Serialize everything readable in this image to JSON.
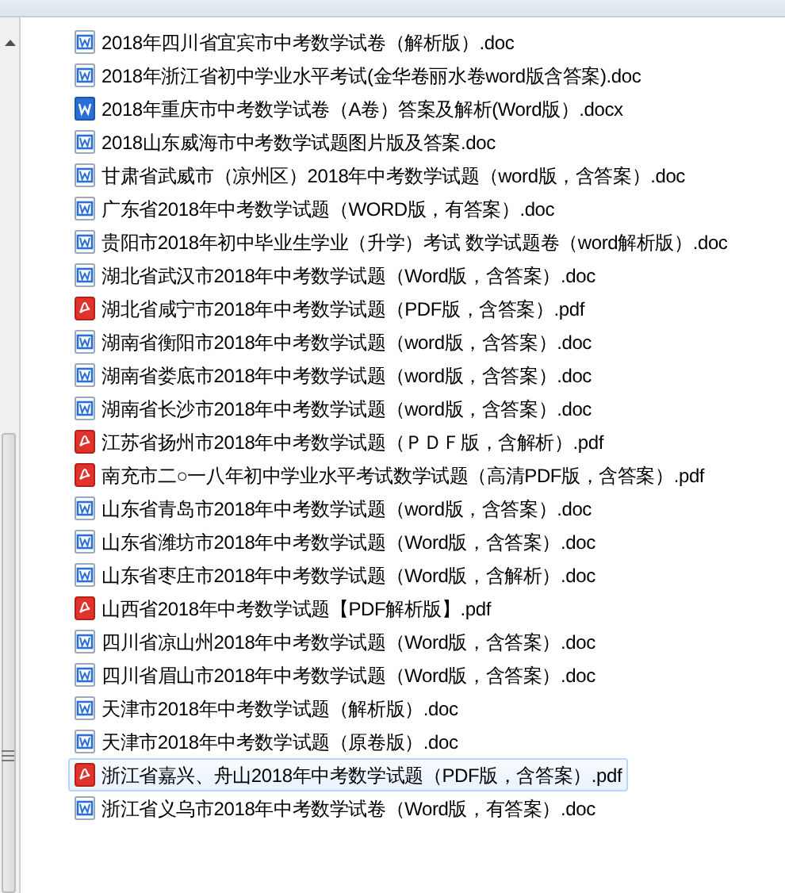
{
  "files": [
    {
      "name": "2018年四川省宜宾市中考数学试卷（解析版）.doc",
      "kind": "word",
      "selected": false
    },
    {
      "name": "2018年浙江省初中学业水平考试(金华卷丽水卷word版含答案).doc",
      "kind": "word",
      "selected": false
    },
    {
      "name": "2018年重庆市中考数学试卷（A卷）答案及解析(Word版）.docx",
      "kind": "wordx",
      "selected": false
    },
    {
      "name": "2018山东威海市中考数学试题图片版及答案.doc",
      "kind": "word",
      "selected": false
    },
    {
      "name": "甘肃省武威市（凉州区）2018年中考数学试题（word版，含答案）.doc",
      "kind": "word",
      "selected": false
    },
    {
      "name": "广东省2018年中考数学试题（WORD版，有答案）.doc",
      "kind": "word",
      "selected": false
    },
    {
      "name": "贵阳市2018年初中毕业生学业（升学）考试 数学试题卷（word解析版）.doc",
      "kind": "word",
      "selected": false
    },
    {
      "name": "湖北省武汉市2018年中考数学试题（Word版，含答案）.doc",
      "kind": "word",
      "selected": false
    },
    {
      "name": "湖北省咸宁市2018年中考数学试题（PDF版，含答案）.pdf",
      "kind": "pdf",
      "selected": false
    },
    {
      "name": "湖南省衡阳市2018年中考数学试题（word版，含答案）.doc",
      "kind": "word",
      "selected": false
    },
    {
      "name": "湖南省娄底市2018年中考数学试题（word版，含答案）.doc",
      "kind": "word",
      "selected": false
    },
    {
      "name": "湖南省长沙市2018年中考数学试题（word版，含答案）.doc",
      "kind": "word",
      "selected": false
    },
    {
      "name": "江苏省扬州市2018年中考数学试题（ＰＤＦ版，含解析）.pdf",
      "kind": "pdf",
      "selected": false
    },
    {
      "name": "南充市二○一八年初中学业水平考试数学试题（高清PDF版，含答案）.pdf",
      "kind": "pdf",
      "selected": false
    },
    {
      "name": "山东省青岛市2018年中考数学试题（word版，含答案）.doc",
      "kind": "word",
      "selected": false
    },
    {
      "name": "山东省潍坊市2018年中考数学试题（Word版，含答案）.doc",
      "kind": "word",
      "selected": false
    },
    {
      "name": "山东省枣庄市2018年中考数学试题（Word版，含解析）.doc",
      "kind": "word",
      "selected": false
    },
    {
      "name": "山西省2018年中考数学试题【PDF解析版】.pdf",
      "kind": "pdf",
      "selected": false
    },
    {
      "name": "四川省凉山州2018年中考数学试题（Word版，含答案）.doc",
      "kind": "word",
      "selected": false
    },
    {
      "name": "四川省眉山市2018年中考数学试题（Word版，含答案）.doc",
      "kind": "word",
      "selected": false
    },
    {
      "name": "天津市2018年中考数学试题（解析版）.doc",
      "kind": "word",
      "selected": false
    },
    {
      "name": "天津市2018年中考数学试题（原卷版）.doc",
      "kind": "word",
      "selected": false
    },
    {
      "name": "浙江省嘉兴、舟山2018年中考数学试题（PDF版，含答案）.pdf",
      "kind": "pdf",
      "selected": true
    },
    {
      "name": "浙江省义乌市2018年中考数学试卷（Word版，有答案）.doc",
      "kind": "word",
      "selected": false
    }
  ]
}
